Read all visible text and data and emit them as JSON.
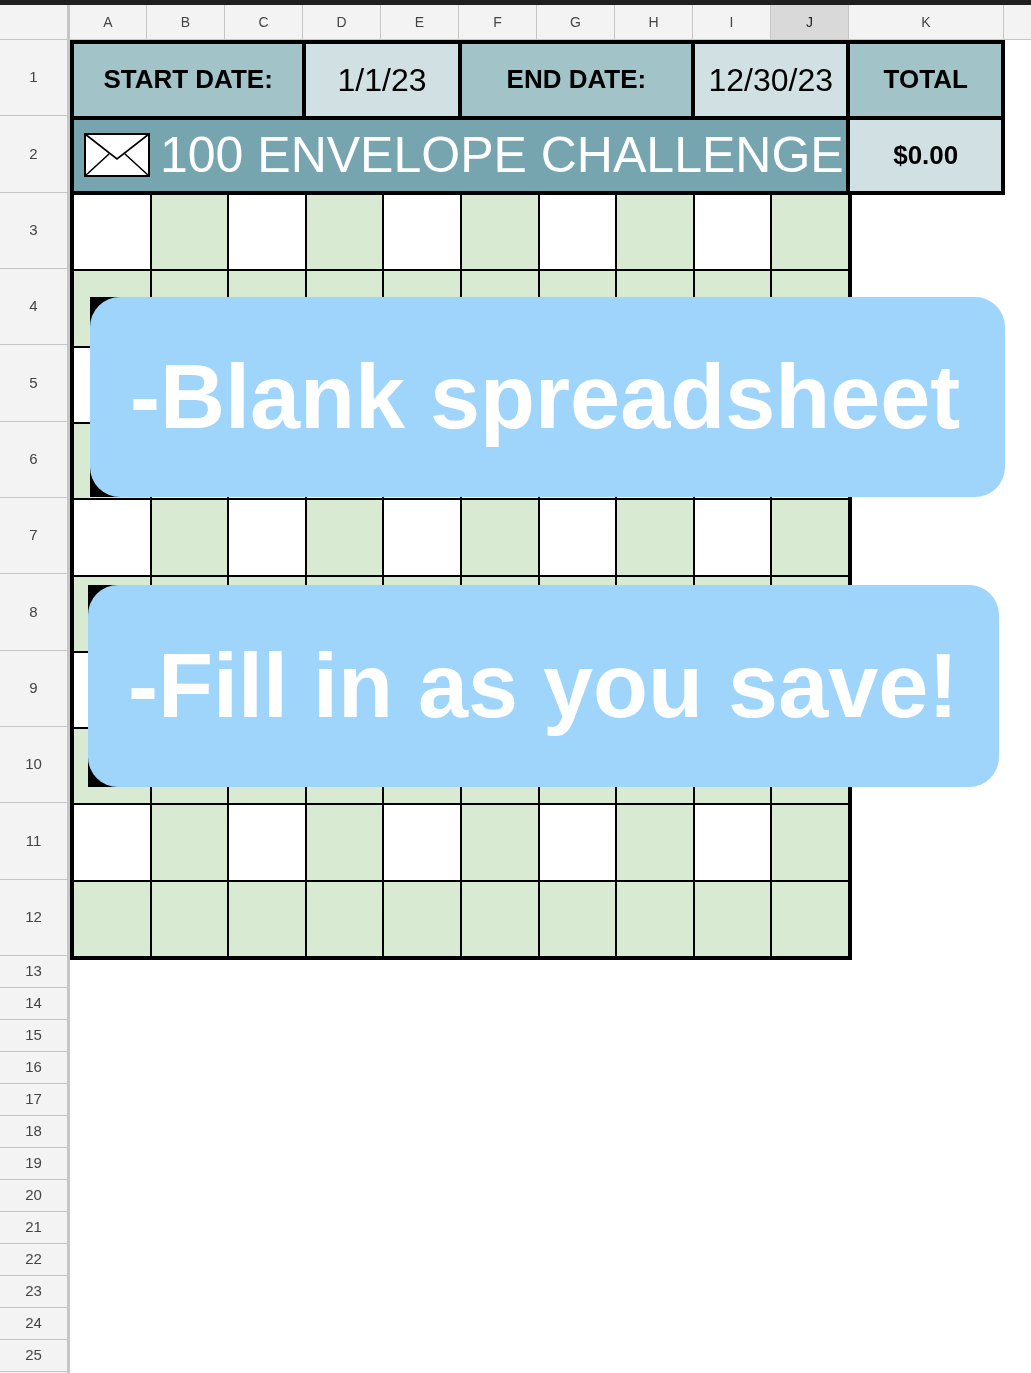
{
  "column_headers": [
    {
      "label": "A",
      "selected": false
    },
    {
      "label": "B",
      "selected": false
    },
    {
      "label": "C",
      "selected": false
    },
    {
      "label": "D",
      "selected": false
    },
    {
      "label": "E",
      "selected": false
    },
    {
      "label": "F",
      "selected": false
    },
    {
      "label": "G",
      "selected": false
    },
    {
      "label": "H",
      "selected": false
    },
    {
      "label": "I",
      "selected": false
    },
    {
      "label": "J",
      "selected": true
    },
    {
      "label": "K",
      "selected": false
    }
  ],
  "row_headers": [
    {
      "label": "1",
      "selected": false
    },
    {
      "label": "2",
      "selected": false
    },
    {
      "label": "3",
      "selected": false
    },
    {
      "label": "4",
      "selected": false
    },
    {
      "label": "5",
      "selected": false
    },
    {
      "label": "6",
      "selected": false
    },
    {
      "label": "7",
      "selected": false
    },
    {
      "label": "8",
      "selected": false
    },
    {
      "label": "9",
      "selected": false
    },
    {
      "label": "10",
      "selected": false
    },
    {
      "label": "11",
      "selected": false
    },
    {
      "label": "12",
      "selected": false
    },
    {
      "label": "13",
      "selected": false
    },
    {
      "label": "14",
      "selected": false
    },
    {
      "label": "15",
      "selected": false
    },
    {
      "label": "16",
      "selected": false
    },
    {
      "label": "17",
      "selected": false
    },
    {
      "label": "18",
      "selected": false
    },
    {
      "label": "19",
      "selected": false
    },
    {
      "label": "20",
      "selected": false
    },
    {
      "label": "21",
      "selected": false
    },
    {
      "label": "22",
      "selected": false
    },
    {
      "label": "23",
      "selected": false
    },
    {
      "label": "24",
      "selected": false
    },
    {
      "label": "25",
      "selected": false
    }
  ],
  "header": {
    "start_label": "START DATE:",
    "start_date": "1/1/23",
    "end_label": "END DATE:",
    "end_date": "12/30/23",
    "total_label": "TOTAL",
    "title": "100 ENVELOPE CHALLENGE",
    "total": "$0.00"
  },
  "envelope_grid": {
    "rows": [
      [
        {
          "color": "#ffffff"
        },
        {
          "color": "#d9ead3"
        },
        {
          "color": "#ffffff"
        },
        {
          "color": "#d9ead3"
        },
        {
          "color": "#ffffff"
        },
        {
          "color": "#d9ead3"
        },
        {
          "color": "#ffffff"
        },
        {
          "color": "#d9ead3"
        },
        {
          "color": "#ffffff"
        },
        {
          "color": "#d9ead3"
        }
      ],
      [
        {
          "color": "#d9ead3"
        },
        {
          "color": "#d9ead3"
        },
        {
          "color": "#d9ead3"
        },
        {
          "color": "#d9ead3"
        },
        {
          "color": "#d9ead3"
        },
        {
          "color": "#d9ead3"
        },
        {
          "color": "#d9ead3"
        },
        {
          "color": "#d9ead3"
        },
        {
          "color": "#d9ead3"
        },
        {
          "color": "#d9ead3"
        }
      ],
      [
        {
          "color": "#ffffff"
        },
        null,
        null,
        null,
        null,
        null,
        null,
        null,
        null,
        null
      ],
      [
        {
          "color": "#d9ead3"
        },
        null,
        null,
        null,
        null,
        null,
        null,
        null,
        null,
        null
      ],
      [
        {
          "color": "#ffffff"
        },
        {
          "color": "#d9ead3"
        },
        {
          "color": "#ffffff"
        },
        {
          "color": "#d9ead3"
        },
        {
          "color": "#ffffff"
        },
        {
          "color": "#d9ead3"
        },
        {
          "color": "#ffffff"
        },
        {
          "color": "#d9ead3"
        },
        {
          "color": "#ffffff"
        },
        {
          "color": "#d9ead3"
        }
      ],
      [
        {
          "color": "#d9ead3"
        },
        {
          "color": "#d9ead3"
        },
        {
          "color": "#d9ead3"
        },
        {
          "color": "#d9ead3"
        },
        {
          "color": "#d9ead3"
        },
        {
          "color": "#d9ead3"
        },
        {
          "color": "#d9ead3"
        },
        {
          "color": "#d9ead3"
        },
        {
          "color": "#d9ead3"
        },
        {
          "color": "#d9ead3"
        }
      ],
      [
        {
          "color": "#ffffff"
        },
        null,
        null,
        null,
        null,
        null,
        null,
        null,
        null,
        null
      ],
      [
        {
          "color": "#d9ead3"
        },
        {
          "color": "#d9ead3"
        },
        {
          "color": "#d9ead3"
        },
        {
          "color": "#d9ead3"
        },
        {
          "color": "#d9ead3"
        },
        {
          "color": "#d9ead3"
        },
        {
          "color": "#d9ead3"
        },
        {
          "color": "#d9ead3"
        },
        {
          "color": "#d9ead3"
        },
        {
          "color": "#d9ead3"
        }
      ],
      [
        {
          "color": "#ffffff"
        },
        {
          "color": "#d9ead3"
        },
        {
          "color": "#ffffff"
        },
        {
          "color": "#d9ead3"
        },
        {
          "color": "#ffffff"
        },
        {
          "color": "#d9ead3"
        },
        {
          "color": "#ffffff"
        },
        {
          "color": "#d9ead3"
        },
        {
          "color": "#ffffff"
        },
        {
          "color": "#d9ead3"
        }
      ],
      [
        {
          "color": "#d9ead3"
        },
        {
          "color": "#d9ead3"
        },
        {
          "color": "#d9ead3"
        },
        {
          "color": "#d9ead3"
        },
        {
          "color": "#d9ead3"
        },
        {
          "color": "#d9ead3"
        },
        {
          "color": "#d9ead3"
        },
        {
          "color": "#d9ead3"
        },
        {
          "color": "#d9ead3"
        },
        {
          "color": "#d9ead3"
        }
      ]
    ]
  },
  "callouts": [
    {
      "text": "-Blank spreadsheet"
    },
    {
      "text": "-Fill in as you save!"
    }
  ]
}
